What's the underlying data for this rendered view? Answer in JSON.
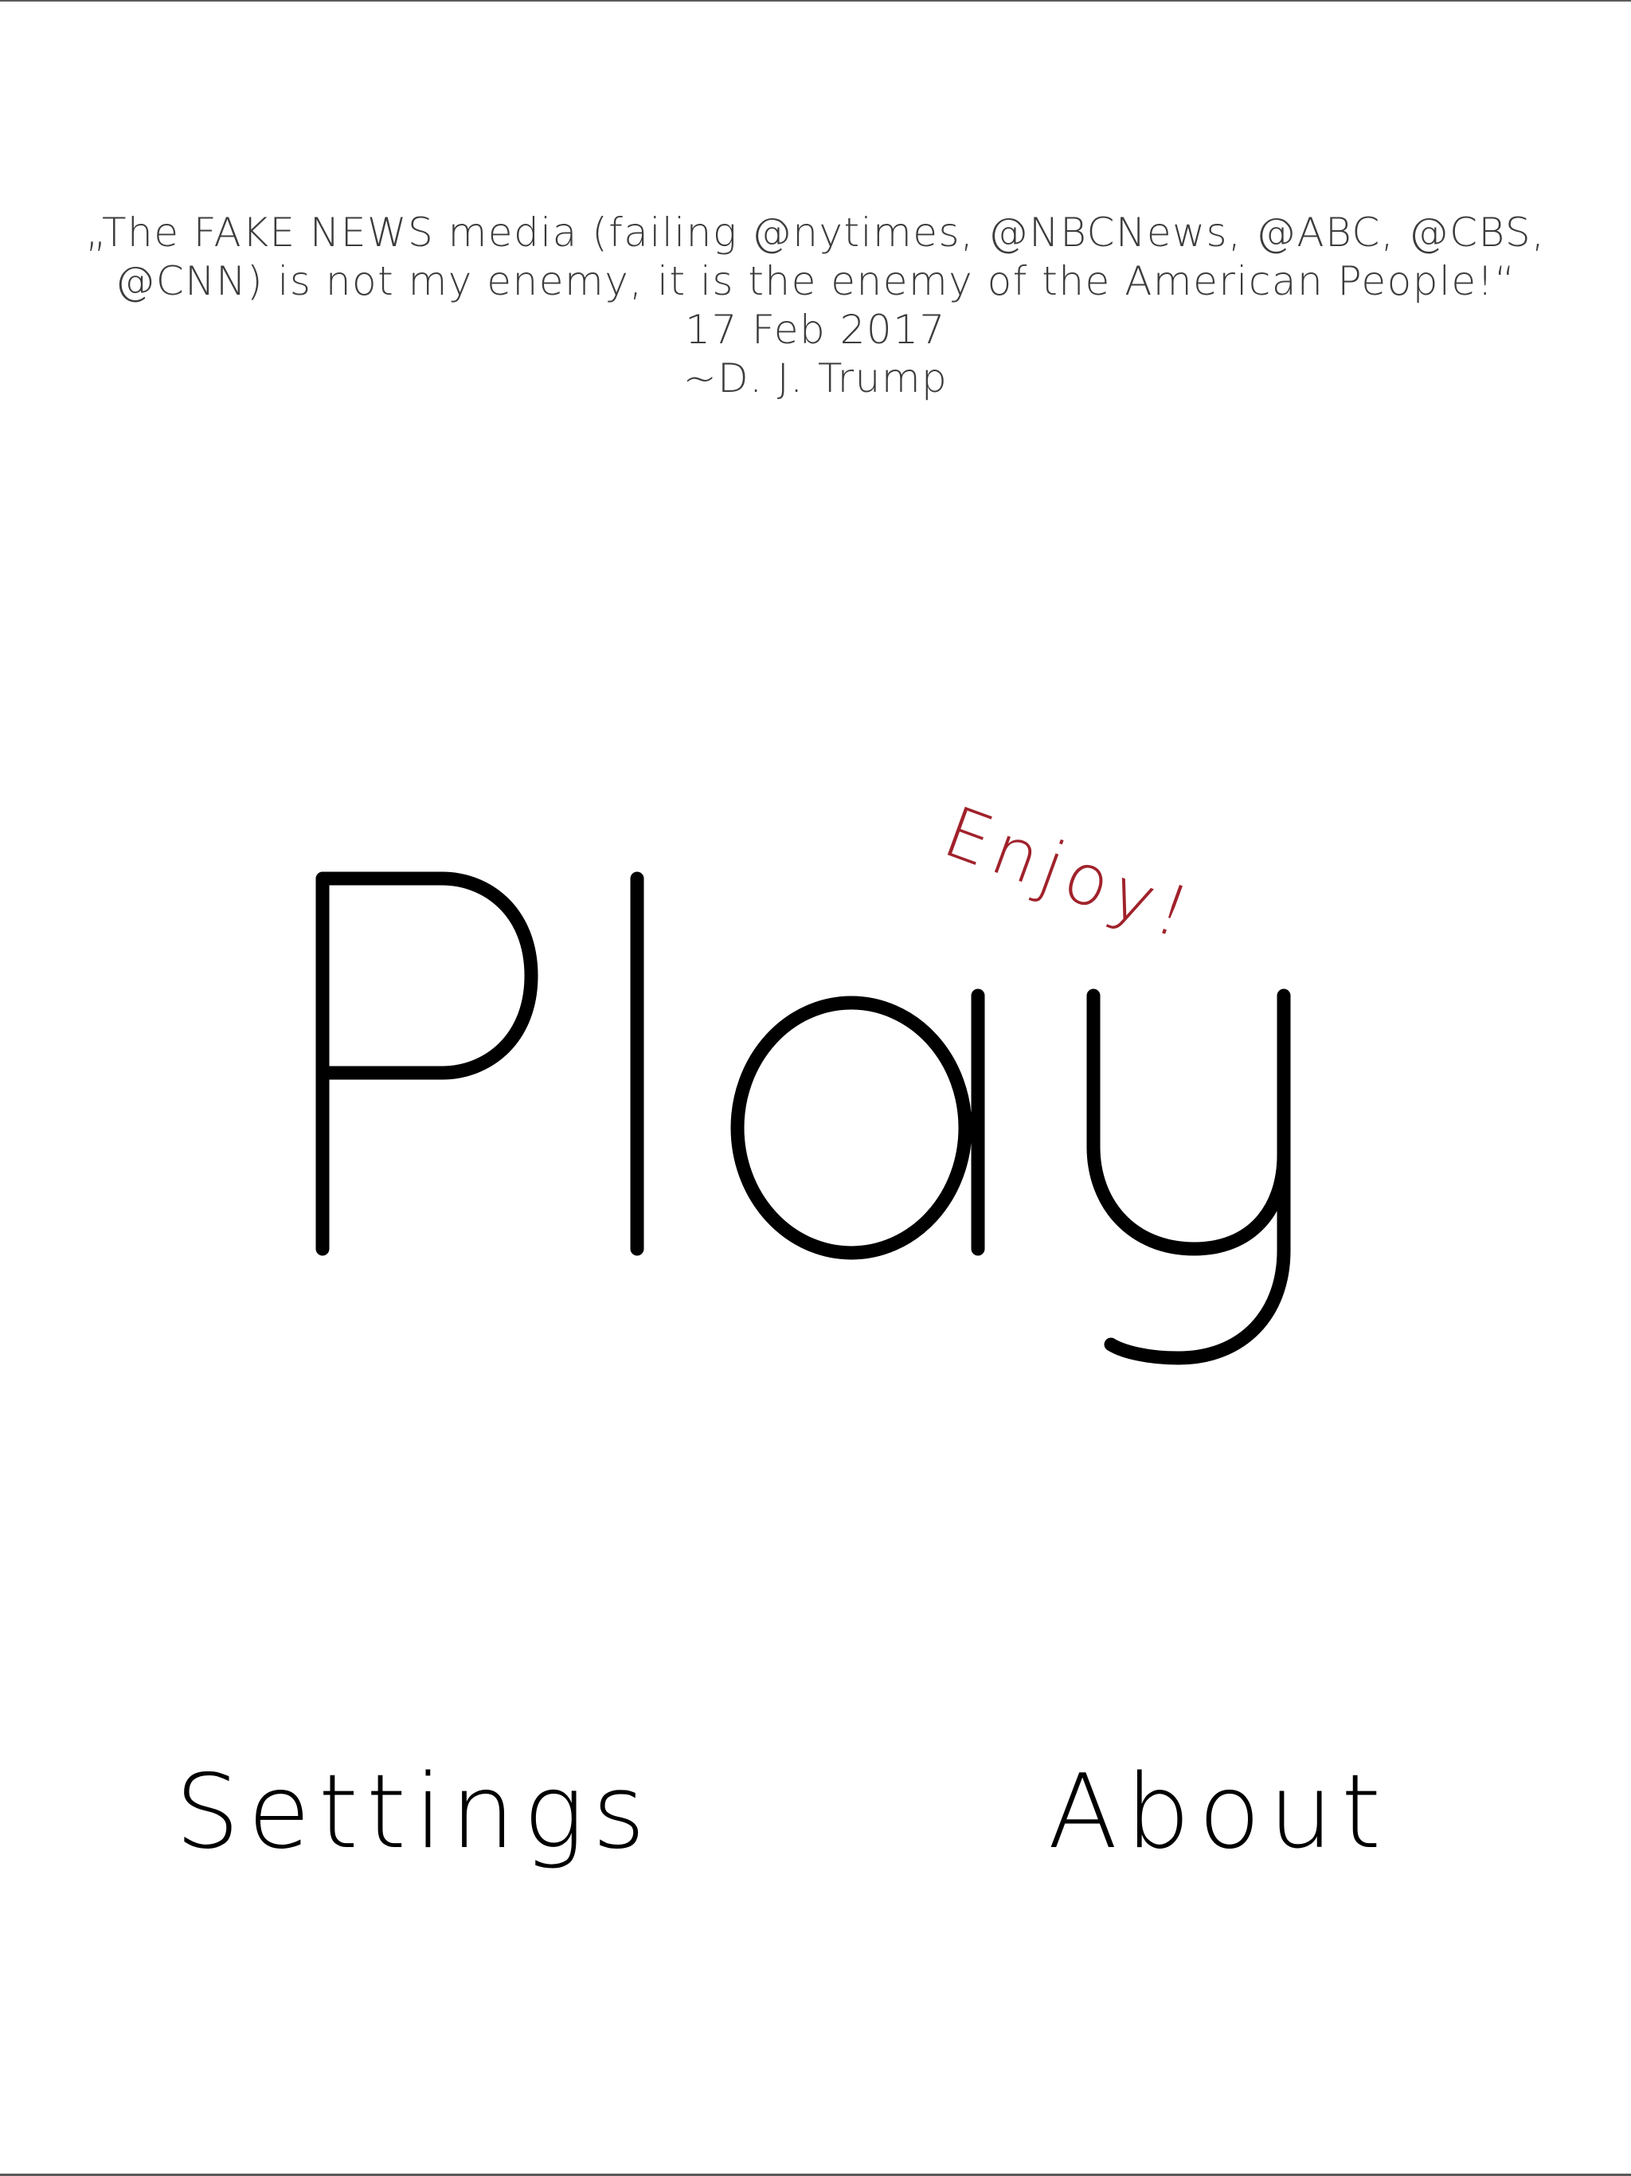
{
  "quote": {
    "line1": "„The FAKE NEWS media (failing @nytimes, @NBCNews, @ABC, @CBS,",
    "line2": "@CNN) is not my enemy, it is the enemy of the American People!“",
    "date": "17 Feb 2017",
    "author": "~D. J. Trump"
  },
  "menu": {
    "play_label": "Play",
    "enjoy_label": "Enjoy!",
    "settings_label": "Settings",
    "about_label": "About"
  },
  "colors": {
    "background": "#ffffff",
    "text": "#000000",
    "quote_text": "#3c3c3c",
    "accent": "#a0222b"
  }
}
